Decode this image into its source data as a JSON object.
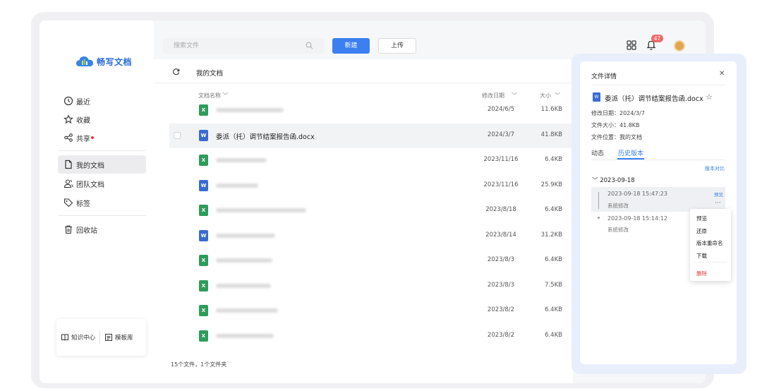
{
  "app": {
    "logo_text": "畅写文档",
    "brand_color": "#3b7ff0"
  },
  "sidebar": {
    "items": [
      {
        "label": "最近",
        "icon": "clock-icon"
      },
      {
        "label": "收藏",
        "icon": "star-icon"
      },
      {
        "label": "共享",
        "icon": "share-icon",
        "has_dot": true
      },
      {
        "label": "我的文档",
        "icon": "document-icon",
        "active": true
      },
      {
        "label": "团队文档",
        "icon": "team-icon"
      },
      {
        "label": "标签",
        "icon": "tag-icon"
      },
      {
        "label": "回收站",
        "icon": "trash-icon"
      }
    ],
    "bottom": {
      "knowledge_label": "知识中心",
      "template_label": "模板库"
    }
  },
  "toolbar": {
    "search_placeholder": "搜索文件",
    "new_label": "新建",
    "upload_label": "上传",
    "notification_count": "47"
  },
  "main": {
    "breadcrumb": "我的文档",
    "columns": {
      "name": "文档名称",
      "date": "修改日期",
      "size": "大小"
    },
    "files": [
      {
        "type": "xls",
        "name": "",
        "date": "2024/6/5",
        "size": "11.6KB"
      },
      {
        "type": "doc",
        "name": "委派（托）调节结案报告函.docx",
        "date": "2024/3/7",
        "size": "41.8KB",
        "selected": true
      },
      {
        "type": "xls",
        "name": "",
        "date": "2023/11/16",
        "size": "6.4KB"
      },
      {
        "type": "doc",
        "name": "",
        "date": "2023/11/16",
        "size": "25.9KB"
      },
      {
        "type": "xls",
        "name": "",
        "date": "2023/8/18",
        "size": "6.4KB"
      },
      {
        "type": "doc",
        "name": "",
        "date": "2023/8/14",
        "size": "31.2KB"
      },
      {
        "type": "xls",
        "name": "",
        "date": "2023/8/3",
        "size": "6.4KB"
      },
      {
        "type": "xls",
        "name": "",
        "date": "2023/8/3",
        "size": "7.5KB"
      },
      {
        "type": "xls",
        "name": "",
        "date": "2023/8/2",
        "size": "6.4KB"
      },
      {
        "type": "xls",
        "name": "",
        "date": "2023/8/2",
        "size": "6.4KB"
      }
    ],
    "footer": "15个文件，1个文件夹"
  },
  "detail": {
    "title": "文件详情",
    "file_name": "委派（托）调节结案报告函.docx",
    "modified": "修改日期：2024/3/7",
    "size": "文件大小：41.8KB",
    "location": "文件位置：我的文档",
    "tabs": [
      "动态",
      "历史版本"
    ],
    "compare_label": "版本对比",
    "group_date": "2023-09-18",
    "versions": [
      {
        "time": "2023-09-18 15:47:23",
        "op": "系统修改",
        "preview_label": "预览"
      },
      {
        "time": "2023-09-18 15:14:12",
        "op": "系统修改"
      }
    ],
    "context_menu": [
      "预览",
      "还原",
      "版本重命名",
      "下载",
      "删除"
    ]
  }
}
